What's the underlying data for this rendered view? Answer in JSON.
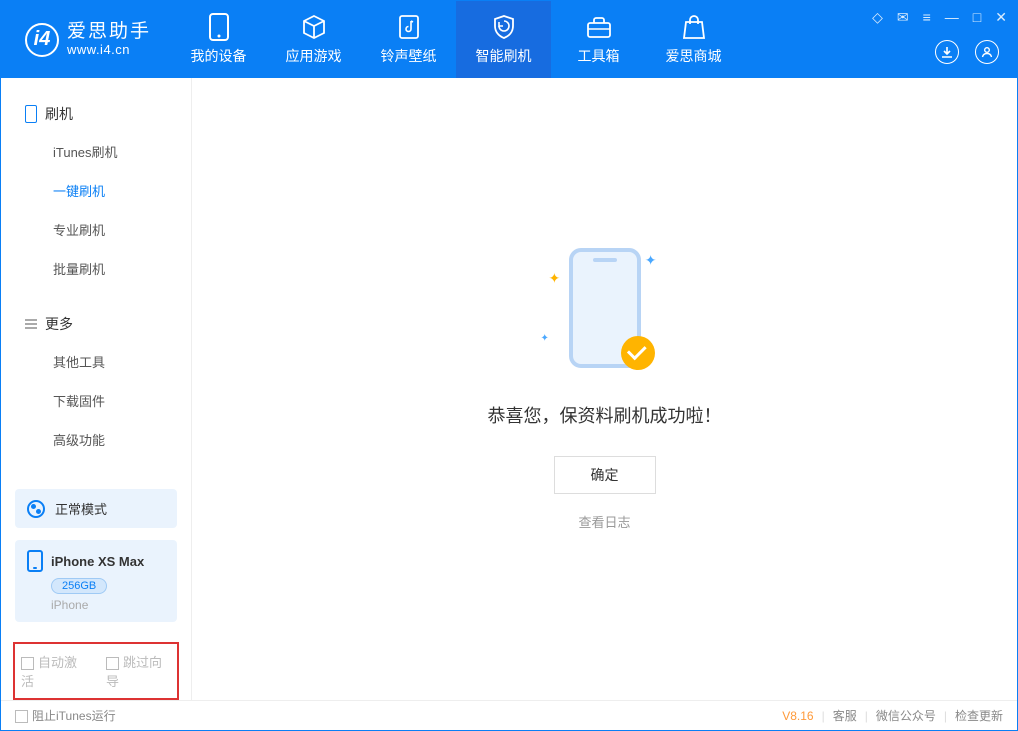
{
  "app": {
    "name": "爱思助手",
    "url": "www.i4.cn"
  },
  "tabs": [
    {
      "label": "我的设备"
    },
    {
      "label": "应用游戏"
    },
    {
      "label": "铃声壁纸"
    },
    {
      "label": "智能刷机"
    },
    {
      "label": "工具箱"
    },
    {
      "label": "爱思商城"
    }
  ],
  "sidebar": {
    "group1": {
      "title": "刷机",
      "items": [
        "iTunes刷机",
        "一键刷机",
        "专业刷机",
        "批量刷机"
      ]
    },
    "group2": {
      "title": "更多",
      "items": [
        "其他工具",
        "下载固件",
        "高级功能"
      ]
    }
  },
  "status": {
    "mode": "正常模式"
  },
  "device": {
    "name": "iPhone XS Max",
    "storage": "256GB",
    "type": "iPhone"
  },
  "checkboxes": {
    "auto_activate": "自动激活",
    "skip_guide": "跳过向导"
  },
  "main": {
    "success": "恭喜您，保资料刷机成功啦！",
    "confirm": "确定",
    "view_log": "查看日志"
  },
  "footer": {
    "block_itunes": "阻止iTunes运行",
    "version": "V8.16",
    "support": "客服",
    "wechat": "微信公众号",
    "update": "检查更新"
  }
}
